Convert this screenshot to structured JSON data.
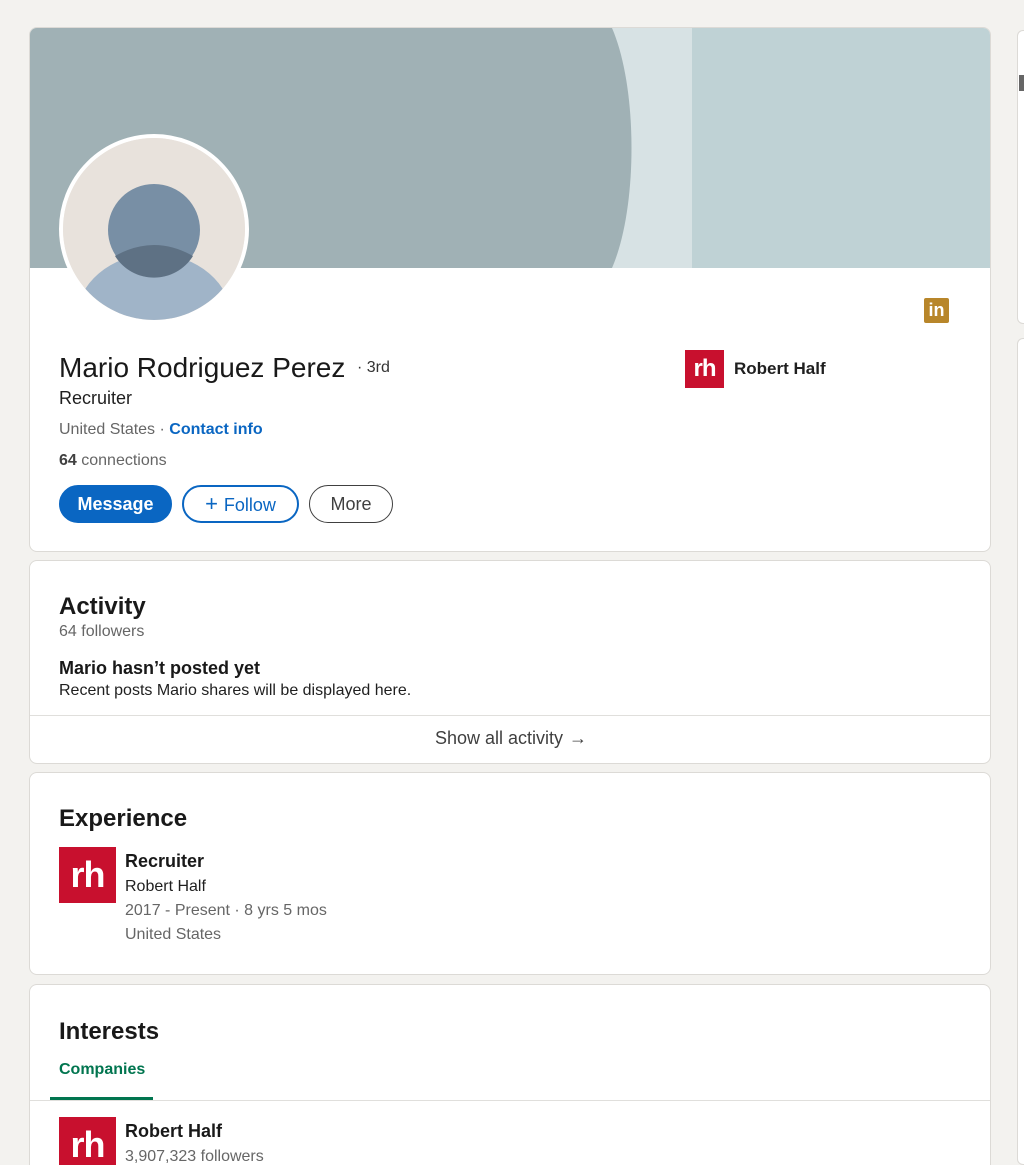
{
  "colors": {
    "primary_blue": "#0a66c2",
    "brand_red": "#c8102e",
    "linkedin_badge": "#b8862a",
    "tab_green": "#01754f",
    "page_bg": "#f3f2ef"
  },
  "profile": {
    "name": "Mario Rodriguez Perez",
    "degree": "· 3rd",
    "headline": "Recruiter",
    "location": "United States",
    "separator": " · ",
    "contact_info": "Contact info",
    "connections_count": "64",
    "connections_label": " connections",
    "badge_text": "in",
    "current_company": {
      "logo_text": "rh",
      "name": "Robert Half"
    },
    "buttons": {
      "message": "Message",
      "follow_icon": "+",
      "follow": "Follow",
      "more": "More"
    }
  },
  "activity": {
    "title": "Activity",
    "followers": "64 followers",
    "empty_title": "Mario hasn’t posted yet",
    "empty_subtitle": "Recent posts Mario shares will be displayed here.",
    "show_all": "Show all activity",
    "show_all_icon": "→"
  },
  "experience": {
    "title": "Experience",
    "items": [
      {
        "logo_text": "rh",
        "role": "Recruiter",
        "company": "Robert Half",
        "dates": "2017 - Present · 8 yrs 5 mos",
        "location": "United States"
      }
    ]
  },
  "interests": {
    "title": "Interests",
    "tabs": [
      {
        "label": "Companies",
        "selected": true
      }
    ],
    "items": [
      {
        "logo_text": "rh",
        "name": "Robert Half",
        "followers": "3,907,323 followers"
      }
    ]
  }
}
